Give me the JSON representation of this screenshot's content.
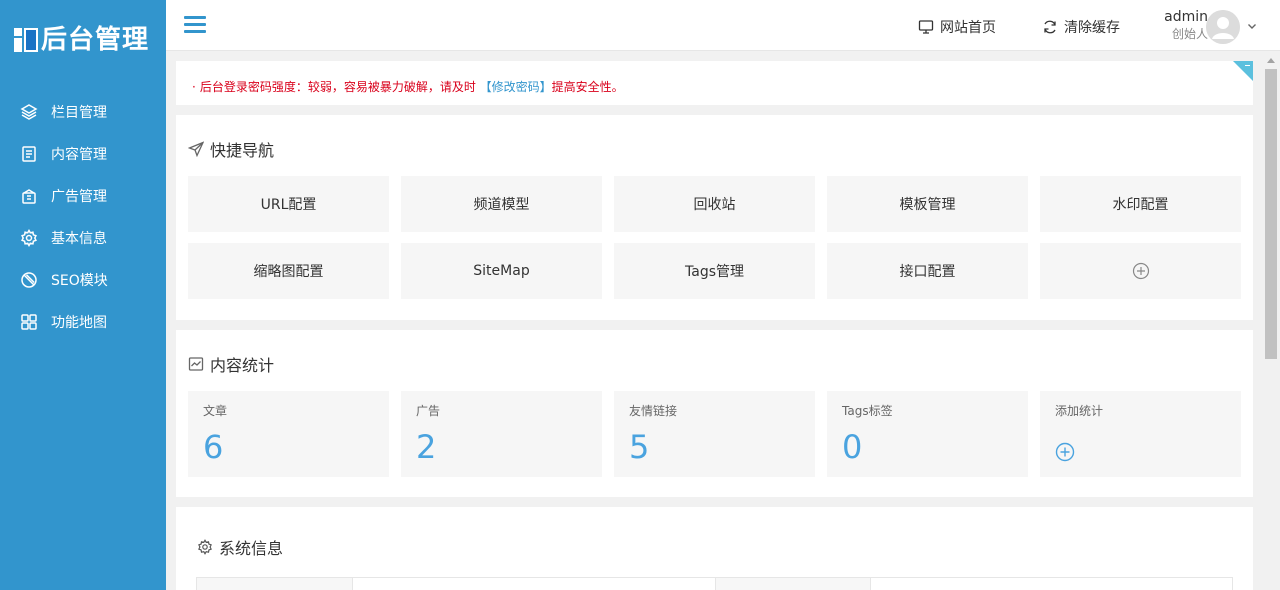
{
  "brand": {
    "logo_text": "后台管理"
  },
  "sidebar": {
    "items": [
      {
        "label": "栏目管理",
        "icon": "layers-icon"
      },
      {
        "label": "内容管理",
        "icon": "document-icon"
      },
      {
        "label": "广告管理",
        "icon": "ad-icon"
      },
      {
        "label": "基本信息",
        "icon": "gear-icon"
      },
      {
        "label": "SEO模块",
        "icon": "no-entry-icon"
      },
      {
        "label": "功能地图",
        "icon": "grid-icon"
      }
    ]
  },
  "header": {
    "site_home_label": "网站首页",
    "clear_cache_label": "清除缓存",
    "user_name": "admin",
    "user_role": "创始人"
  },
  "notice": {
    "bullet": "·",
    "text_before": "后台登录密码强度：较弱，容易被暴力破解，请及时 ",
    "link_text": "【修改密码】",
    "text_after": "提高安全性。"
  },
  "quick_nav": {
    "title": "快捷导航",
    "tiles": [
      "URL配置",
      "频道模型",
      "回收站",
      "模板管理",
      "水印配置",
      "缩略图配置",
      "SiteMap",
      "Tags管理",
      "接口配置"
    ]
  },
  "content_stats": {
    "title": "内容统计",
    "items": [
      {
        "label": "文章",
        "value": "6"
      },
      {
        "label": "广告",
        "value": "2"
      },
      {
        "label": "友情链接",
        "value": "5"
      },
      {
        "label": "Tags标签",
        "value": "0"
      }
    ],
    "add_label": "添加统计"
  },
  "system_info": {
    "title": "系统信息"
  },
  "colors": {
    "sidebar": "#3295cd",
    "accent": "#4aa3df",
    "warning": "#d9001b",
    "corner": "#5bc0de"
  }
}
